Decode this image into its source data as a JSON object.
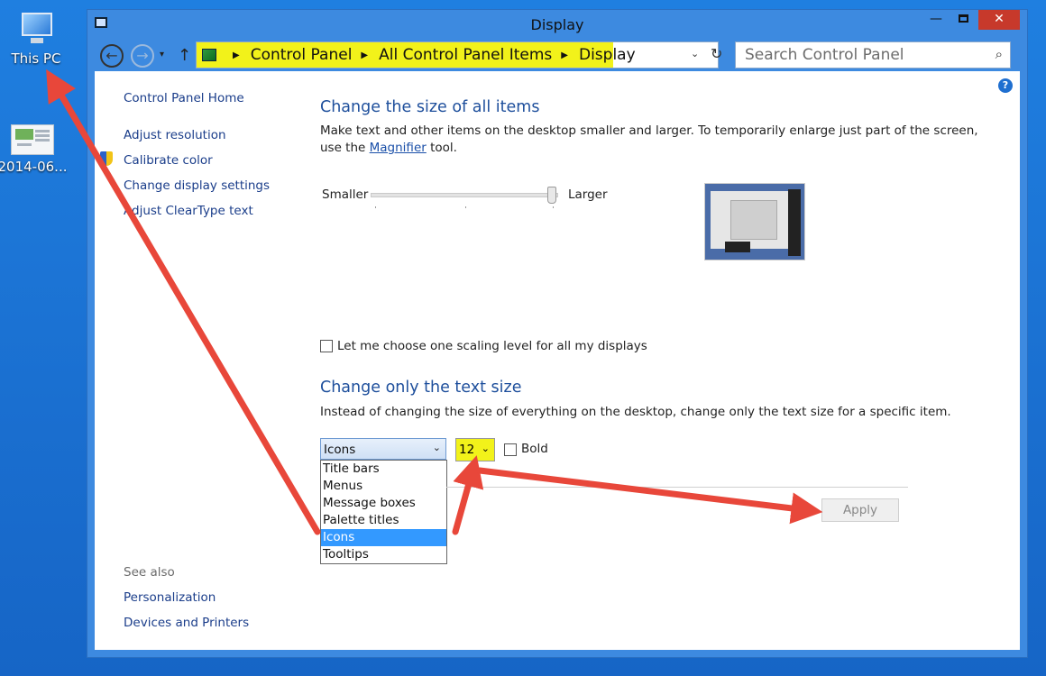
{
  "desktop": {
    "icon1_label": "This PC",
    "icon2_label": "2014-06..."
  },
  "window": {
    "title": "Display",
    "minimize": "—",
    "close": "✕"
  },
  "nav": {
    "back": "←",
    "forward": "→",
    "up": "↑",
    "recent": "▾",
    "crumbs": [
      "Control Panel",
      "All Control Panel Items",
      "Display"
    ],
    "refresh": "↻",
    "addr_dropdown": "⌄"
  },
  "search": {
    "placeholder": "Search Control Panel",
    "icon": "⌕"
  },
  "sidebar": {
    "home": "Control Panel Home",
    "items": [
      "Adjust resolution",
      "Calibrate color",
      "Change display settings",
      "Adjust ClearType text"
    ],
    "see_also": "See also",
    "see_also_links": [
      "Personalization",
      "Devices and Printers"
    ]
  },
  "main": {
    "size_heading": "Change the size of all items",
    "size_desc_1": "Make text and other items on the desktop smaller and larger. To temporarily enlarge just part of the screen,",
    "size_desc_2a": "use the ",
    "size_desc_link": "Magnifier",
    "size_desc_2b": " tool.",
    "slider_smaller": "Smaller",
    "slider_larger": "Larger",
    "slider_level": 1.0,
    "scaling_checkbox": "Let me choose one scaling level for all my displays",
    "text_heading": "Change only the text size",
    "text_desc": "Instead of changing the size of everything on the desktop, change only the text size for a specific item.",
    "item_select_value": "Icons",
    "item_options": [
      "Title bars",
      "Menus",
      "Message boxes",
      "Palette titles",
      "Icons",
      "Tooltips"
    ],
    "selected_option": "Icons",
    "size_value": "12",
    "bold_label": "Bold",
    "apply_label": "Apply"
  },
  "colors": {
    "highlight": "#f2f21a",
    "arrow": "#e8473a",
    "window_frame": "#3d8ae0"
  }
}
